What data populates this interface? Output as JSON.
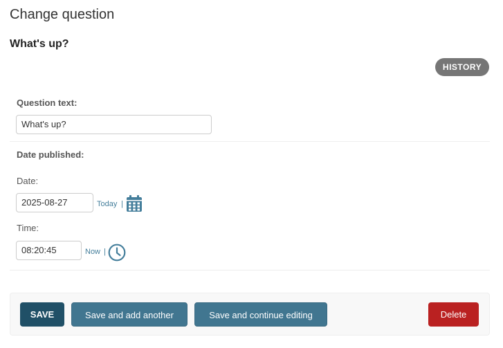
{
  "page": {
    "title": "Change question",
    "object_title": "What's up?"
  },
  "tools": {
    "history_label": "HISTORY"
  },
  "form": {
    "question_text": {
      "label": "Question text:",
      "value": "What's up?"
    },
    "date_published": {
      "label": "Date published:",
      "date": {
        "label": "Date:",
        "value": "2025-08-27",
        "shortcut_label": "Today",
        "separator": "|",
        "icon": "calendar-icon"
      },
      "time": {
        "label": "Time:",
        "value": "08:20:45",
        "shortcut_label": "Now",
        "separator": "|",
        "icon": "clock-icon"
      }
    }
  },
  "submit_row": {
    "save_label": "SAVE",
    "save_add_another_label": "Save and add another",
    "save_continue_label": "Save and continue editing",
    "delete_label": "Delete"
  },
  "colors": {
    "primary": "#205067",
    "secondary": "#417690",
    "link": "#447e9b",
    "delete": "#ba2121",
    "history": "#767676"
  }
}
